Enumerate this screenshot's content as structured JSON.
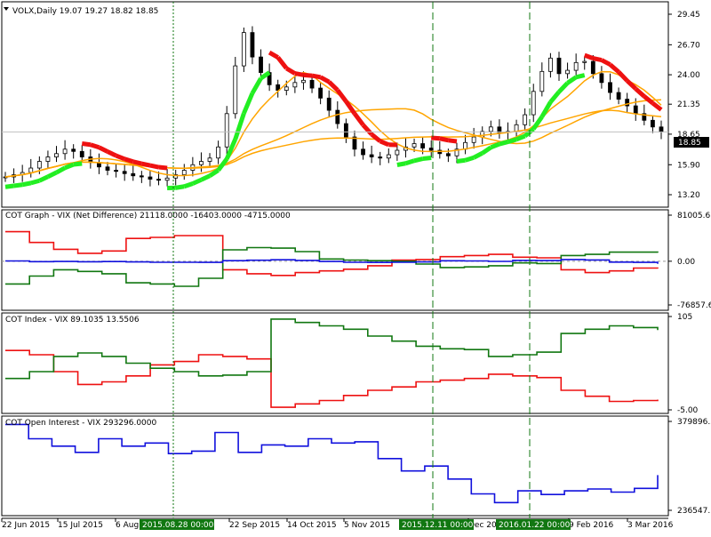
{
  "colors": {
    "background": "#ffffff",
    "frame": "#000000",
    "candles": "#000000",
    "uptrend": "#22ee22",
    "downtrend": "#ee1111",
    "ma": "#ffa500",
    "net_commercial": "#ee1111",
    "net_noncommercial": "#117711",
    "net_total": "#1111dd",
    "open_interest": "#1111dd",
    "period_marker": "#117711",
    "current_price_bg": "#000000"
  },
  "main_panel": {
    "title": "VOLX,Daily  19.07 19.27 18.82 18.85",
    "current_price": "18.85",
    "price_ticks": [
      "29.45",
      "26.70",
      "24.00",
      "21.35",
      "18.65",
      "15.90",
      "13.20"
    ]
  },
  "cot_graph_panel": {
    "title": "COT Graph - VIX (Net Difference)  21118.0000 -16403.0000 -4715.0000",
    "ticks": [
      "81005.6",
      "0.00",
      "-76857.6"
    ]
  },
  "cot_index_panel": {
    "title": "COT Index - VIX 89.1035 13.5506",
    "ticks": [
      "105",
      "-5.00"
    ]
  },
  "open_interest_panel": {
    "title": "COT Open Interest - VIX  293296.0000",
    "ticks": [
      "379896.5",
      "236547.1"
    ]
  },
  "time_axis": {
    "labels": [
      "22 Jun 2015",
      "15 Jul 2015",
      "6 Aug",
      "22 Sep 2015",
      "14 Oct 2015",
      "5 Nov 2015",
      "Dec 20",
      "9 Feb 2016",
      "3 Mar 2016"
    ],
    "markers": [
      "2015.08.28 00:00",
      "2015.12.11 00:00",
      "2016.01.22 00:00"
    ]
  },
  "chart_data": [
    {
      "type": "candlestick",
      "title": "VOLX,Daily",
      "ohlc_last": {
        "open": 19.07,
        "high": 19.27,
        "low": 18.82,
        "close": 18.85
      },
      "ylim": [
        13.2,
        29.45
      ],
      "close_series": [
        14.8,
        15.0,
        15.2,
        15.6,
        16.2,
        16.6,
        16.9,
        17.3,
        17.1,
        16.6,
        16.1,
        15.7,
        15.4,
        15.3,
        15.1,
        14.9,
        14.8,
        14.6,
        14.5,
        14.7,
        15.0,
        15.4,
        15.9,
        16.2,
        16.5,
        17.5,
        20.5,
        24.8,
        27.8,
        25.6,
        24.2,
        23.1,
        22.6,
        22.9,
        23.3,
        23.5,
        22.8,
        21.9,
        20.8,
        19.6,
        18.4,
        17.3,
        16.8,
        16.6,
        16.5,
        16.8,
        17.2,
        17.5,
        17.8,
        17.4,
        17.2,
        16.9,
        16.7,
        17.3,
        17.9,
        18.4,
        18.9,
        19.3,
        18.8,
        18.9,
        19.5,
        20.4,
        22.5,
        24.3,
        25.5,
        24.1,
        24.4,
        25.1,
        25.2,
        24.1,
        23.3,
        22.4,
        21.8,
        21.2,
        20.5,
        19.9,
        19.3,
        18.85
      ],
      "overlay_lines": [
        "uptrend",
        "downtrend",
        "ma-fast",
        "ma-mid",
        "ma-slow"
      ]
    },
    {
      "type": "line",
      "title": "COT Graph - VIX (Net Difference)",
      "last_values": [
        21118,
        -16403,
        -4715
      ],
      "ylim": [
        -76857.6,
        81005.6
      ],
      "series": [
        {
          "color": "net_commercial",
          "values": [
            52000,
            33000,
            21000,
            14000,
            18000,
            40000,
            42000,
            45000,
            45000,
            -15000,
            -22000,
            -25000,
            -20000,
            -17000,
            -14000,
            -8000,
            2000,
            3000,
            8000,
            10000,
            12000,
            7000,
            6000,
            -15000,
            -20000,
            -17000,
            -12000,
            -13000
          ]
        },
        {
          "color": "net_noncommercial",
          "values": [
            -40000,
            -26000,
            -15000,
            -18000,
            -22000,
            -38000,
            -40000,
            -44000,
            -30000,
            20000,
            24000,
            23000,
            17000,
            4000,
            2000,
            1000,
            0,
            -5000,
            -11000,
            -10000,
            -8000,
            -3000,
            -4000,
            10000,
            12000,
            16000,
            16000,
            15000
          ]
        },
        {
          "color": "net_total",
          "values": [
            500,
            -700,
            -500,
            -900,
            -600,
            -1200,
            -1800,
            -1800,
            -2000,
            1000,
            1800,
            2500,
            1500,
            -500,
            -1800,
            -2200,
            -1800,
            -1200,
            800,
            500,
            -200,
            1500,
            1200,
            3000,
            2200,
            -1500,
            -2000,
            -4715
          ]
        }
      ]
    },
    {
      "type": "line",
      "title": "COT Index - VIX",
      "last_values": [
        89.1035,
        13.5506
      ],
      "ylim": [
        -5,
        105
      ],
      "series": [
        {
          "color": "net_commercial",
          "values": [
            65,
            60,
            40,
            25,
            28,
            35,
            48,
            52,
            60,
            58,
            55,
            -2,
            2,
            6,
            12,
            18,
            22,
            28,
            30,
            32,
            37,
            35,
            33,
            18,
            11,
            5,
            6,
            7
          ]
        },
        {
          "color": "net_noncommercial",
          "values": [
            32,
            40,
            58,
            62,
            58,
            50,
            44,
            40,
            35,
            36,
            40,
            102,
            98,
            94,
            90,
            82,
            76,
            70,
            67,
            66,
            58,
            60,
            63,
            85,
            90,
            94,
            92,
            89
          ]
        }
      ]
    },
    {
      "type": "line",
      "title": "COT Open Interest - VIX",
      "last_value": 293296,
      "ylim": [
        236547.1,
        379896.5
      ],
      "series": [
        {
          "color": "open_interest",
          "values": [
            375000,
            352000,
            340000,
            330000,
            352000,
            340000,
            345000,
            328000,
            332000,
            362000,
            330000,
            342000,
            340000,
            352000,
            345000,
            347000,
            320000,
            300000,
            308000,
            287000,
            263000,
            249000,
            268000,
            262000,
            268000,
            271000,
            266000,
            272000,
            293296
          ]
        }
      ]
    }
  ]
}
